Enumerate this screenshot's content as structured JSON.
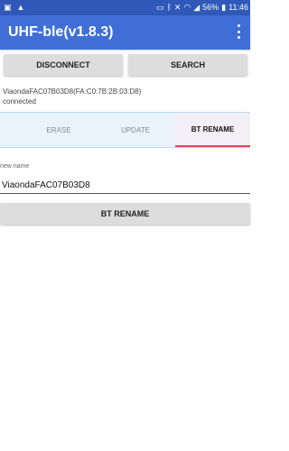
{
  "status_bar": {
    "left_icons": [
      "image-icon",
      "warning-icon"
    ],
    "right_icons": [
      "cast-icon",
      "bluetooth-icon",
      "mute-icon",
      "wifi-icon",
      "signal-icon"
    ],
    "battery": "56%",
    "time": "11:46"
  },
  "app_bar": {
    "title": "UHF-ble(v1.8.3)",
    "menu_icon": "more-vert-icon"
  },
  "toolbar": {
    "disconnect_label": "DISCONNECT",
    "search_label": "SEARCH"
  },
  "device": {
    "name": "ViaondaFAC07B03D8(FA:C0:7B:2B:03:D8)",
    "status": "connected"
  },
  "tabs": [
    {
      "label": "ERASE",
      "active": false
    },
    {
      "label": "UPDATE",
      "active": false
    },
    {
      "label": "BT RENAME",
      "active": true
    }
  ],
  "rename_form": {
    "field_label": "new name",
    "field_value": "ViaondaFAC07B03D8",
    "button_label": "BT RENAME"
  },
  "colors": {
    "status_bar": "#2f58b8",
    "app_bar": "#3f6fd6",
    "tab_strip": "#e8f3fb",
    "active_tab_indicator": "#e8435a"
  }
}
